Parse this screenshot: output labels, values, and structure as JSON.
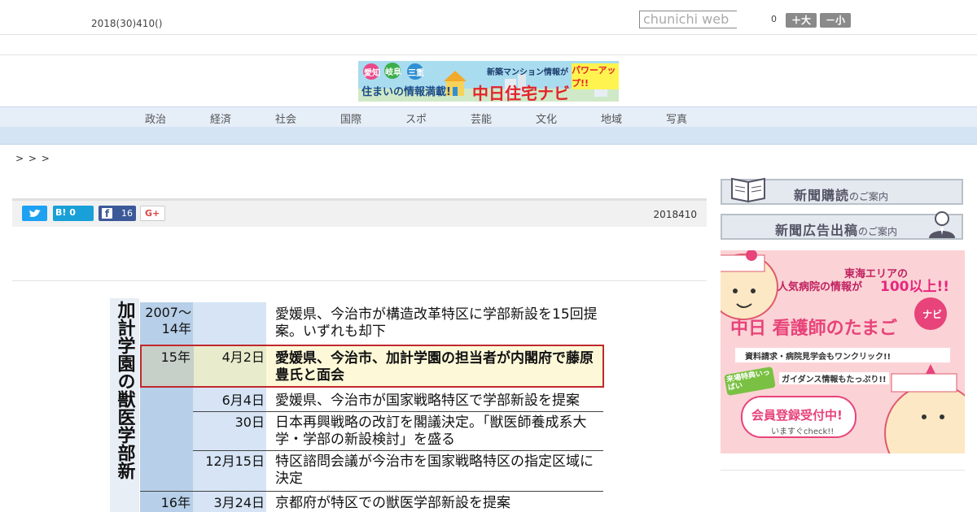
{
  "header": {
    "date": "2018(30)410()",
    "search_placeholder": "chunichi web",
    "counter": "0",
    "font_large": "＋大",
    "font_small": "－小"
  },
  "banner": {
    "pref1": "愛知",
    "pref2": "岐阜",
    "pref3": "三重",
    "tagline": "住まいの情報満載!",
    "top_line": "新築マンション情報が",
    "power_up": "パワーアップ!!",
    "brand": "中日住宅ナビ"
  },
  "nav": {
    "items": [
      "政治",
      "経済",
      "社会",
      "国際",
      "スポ",
      "芸能",
      "文化",
      "地域",
      "写真"
    ]
  },
  "breadcrumb": "> > >",
  "share": {
    "hatena": "B! 0",
    "facebook_count": "16",
    "gplus": "G+",
    "publish_date": "2018410"
  },
  "article": {
    "timeline": {
      "title": "加計学園の獣医学部新",
      "rows": [
        {
          "year": "2007〜 14年",
          "date": "",
          "event": "愛媛県、今治市が構造改革特区に学部新設を15回提案。いずれも却下"
        },
        {
          "year": "15年",
          "date": "4月2日",
          "event": "愛媛県、今治市、加計学園の担当者が内閣府で藤原豊氏と面会"
        },
        {
          "year": "",
          "date": "6月4日",
          "event": "愛媛県、今治市が国家戦略特区で学部新設を提案"
        },
        {
          "year": "",
          "date": "30日",
          "event": "日本再興戦略の改訂を閣議決定。「獣医師養成系大学・学部の新設検討」を盛る"
        },
        {
          "year": "",
          "date": "12月15日",
          "event": "特区諮問会議が今治市を国家戦略特区の指定区域に決定"
        },
        {
          "year": "16年",
          "date": "3月24日",
          "event": "京都府が特区での獣医学部新設を提案"
        }
      ]
    }
  },
  "sidebar": {
    "subscribe_main": "新聞購読",
    "subscribe_sub": "のご案内",
    "ad_main": "新聞広告出稿",
    "ad_sub": "のご案内",
    "nurse_ad": {
      "line1": "東海エリアの",
      "line2": "人気病院の情報が",
      "line2_em": "100以上!!",
      "title": "中日 看護師のたまご",
      "navi": "ナビ",
      "line3": "資料請求・病院見学会もワンクリック!!",
      "badge": "来場特典いっぱい",
      "line4": "ガイダンス情報もたっぷり!!",
      "cta": "会員登録受付中!",
      "cta_sub": "いますぐcheck!!"
    }
  },
  "colors": {
    "nav_bg": "#e6eef8",
    "highlight_border": "#c0282d",
    "twitter": "#1da1f2",
    "hatena": "#19a0d8",
    "facebook": "#3b5998",
    "nurse_pink": "#fbd3d6",
    "nurse_title": "#e8437a"
  },
  "icons": {
    "twitter": "twitter-bird-icon",
    "hatena": "hatena-bookmark-icon",
    "facebook": "facebook-icon",
    "gplus": "google-plus-icon",
    "book": "book-icon",
    "businessman": "businessman-icon",
    "house": "house-icon"
  }
}
